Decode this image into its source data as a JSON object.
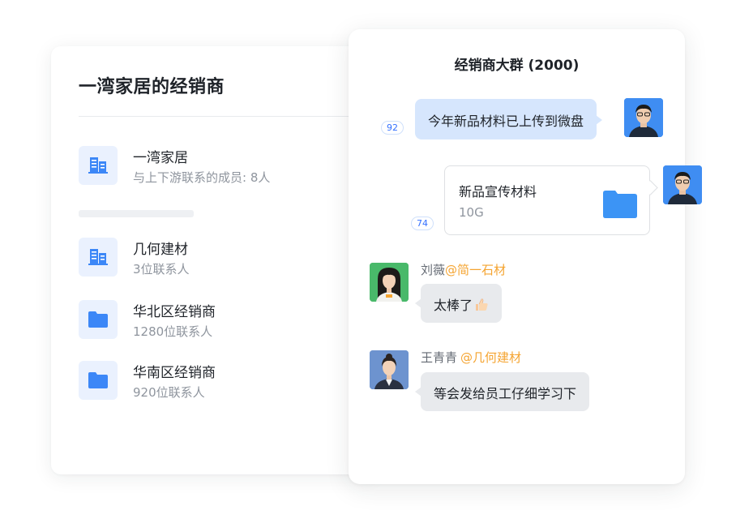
{
  "left_panel": {
    "title": "一湾家居的经销商",
    "company": {
      "name": "一湾家居",
      "subtitle": "与上下游联系的成员: 8人",
      "icon": "building-icon"
    },
    "groups": [
      {
        "name": "几何建材",
        "subtitle": "3位联系人",
        "icon": "building-icon"
      },
      {
        "name": "华北区经销商",
        "subtitle": "1280位联系人",
        "icon": "folder-icon"
      },
      {
        "name": "华南区经销商",
        "subtitle": "920位联系人",
        "icon": "folder-icon"
      }
    ]
  },
  "chat": {
    "title": "经销商大群 (2000)",
    "messages": [
      {
        "type": "text",
        "direction": "outgoing",
        "text": "今年新品材料已上传到微盘",
        "read_count": "92"
      },
      {
        "type": "file",
        "direction": "outgoing",
        "file_name": "新品宣传材料",
        "file_size": "10G",
        "read_count": "74"
      },
      {
        "type": "text",
        "direction": "incoming",
        "sender": "刘薇",
        "org": "@简一石材",
        "text": "太棒了",
        "emoji": "thumbs-up-icon"
      },
      {
        "type": "text",
        "direction": "incoming",
        "sender": "王青青",
        "org": "@几何建材",
        "text": "等会发给员工仔细学习下"
      }
    ]
  },
  "colors": {
    "accent_blue": "#3370ff",
    "icon_blue": "#3c87f7",
    "bubble_blue": "#d6e6fd",
    "bubble_gray": "#e8eaed",
    "org_orange": "#f5a431"
  }
}
